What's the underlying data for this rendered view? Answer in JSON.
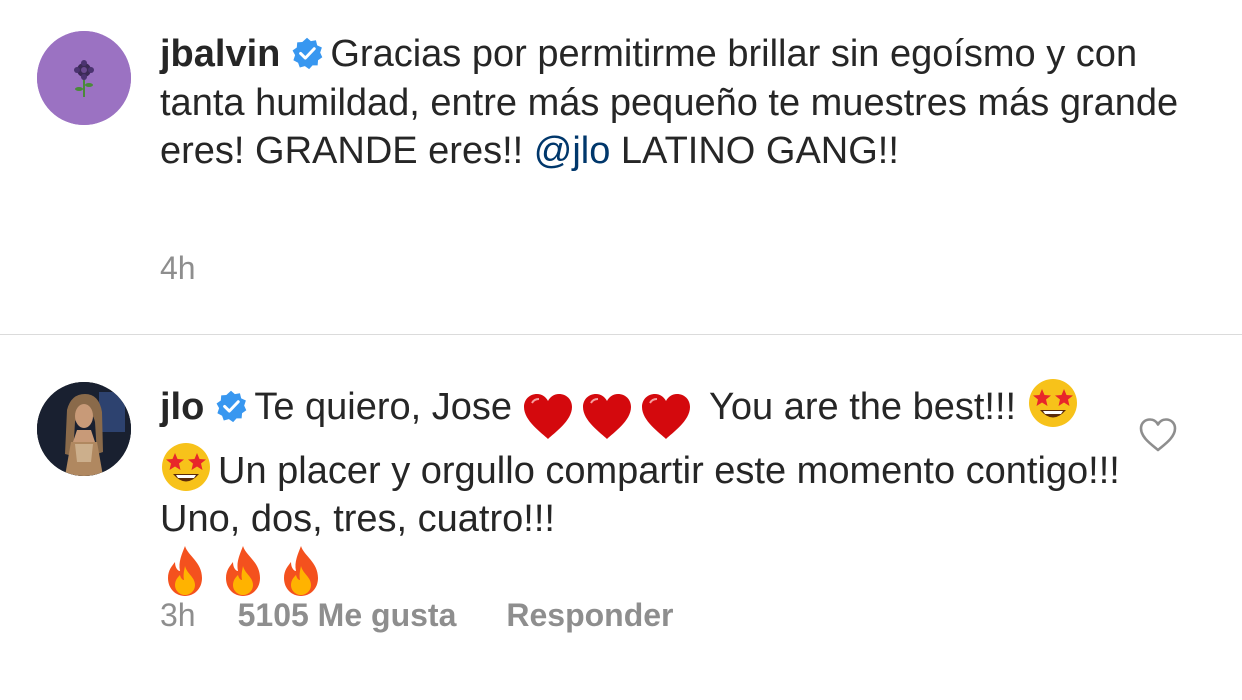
{
  "comments": [
    {
      "username": "jbalvin",
      "text_part1": "Gracias por permitirme brillar sin egoísmo y con tanta humildad, entre más pequeño te muestres más grande eres! GRANDE eres!! ",
      "mention": "@jlo",
      "text_part2": "  LATINO GANG!!",
      "time": "4h",
      "avatar_icon": "sunflower-avatar-icon",
      "verified_icon": "verified-badge-icon"
    },
    {
      "username": "jlo",
      "text_part1": "Te quiero, Jose",
      "text_part2": "You are the best!!! ",
      "text_part3": "Un placer y orgullo compartir este momento contigo!!! Uno, dos, tres, cuatro!!!",
      "emoji_hearts": [
        "red-heart-emoji",
        "red-heart-emoji",
        "red-heart-emoji"
      ],
      "emoji_stars": [
        "star-struck-emoji",
        "star-struck-emoji"
      ],
      "emoji_fires": [
        "fire-emoji",
        "fire-emoji",
        "fire-emoji"
      ],
      "time": "3h",
      "likes": "5105 Me gusta",
      "reply": "Responder",
      "like_icon": "heart-outline-icon",
      "avatar_icon": "profile-photo-avatar",
      "verified_icon": "verified-badge-icon"
    }
  ],
  "colors": {
    "text": "#262626",
    "meta": "#8e8e8e",
    "mention": "#00376b",
    "verified": "#3897f0",
    "divider": "#dbdbdb"
  }
}
